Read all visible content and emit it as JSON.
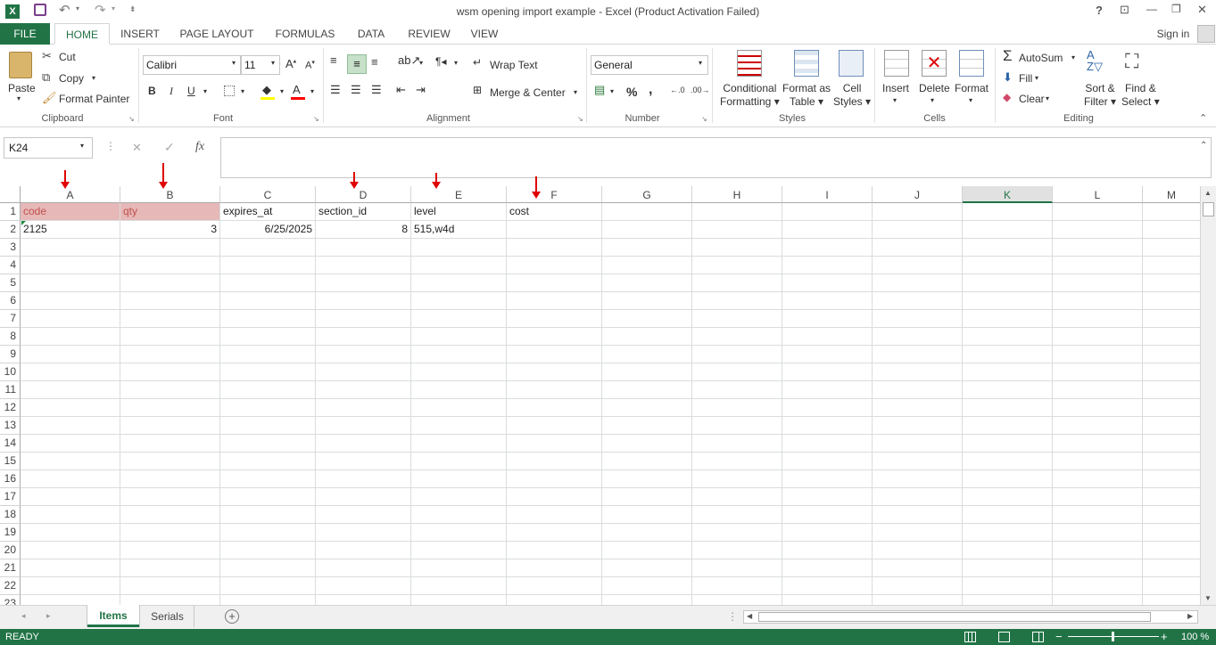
{
  "title": "wsm opening import example - Excel (Product Activation Failed)",
  "window_buttons": {
    "help": "?",
    "restore_ribbon": "⊡",
    "minimize": "—",
    "maximize": "❐",
    "close": "✕"
  },
  "ribbon_tabs": [
    "FILE",
    "HOME",
    "INSERT",
    "PAGE LAYOUT",
    "FORMULAS",
    "DATA",
    "REVIEW",
    "VIEW"
  ],
  "sign_in": "Sign in",
  "clipboard": {
    "paste": "Paste",
    "cut": "Cut",
    "copy": "Copy",
    "format_painter": "Format Painter",
    "label": "Clipboard"
  },
  "font": {
    "name": "Calibri",
    "size": "11",
    "bold": "B",
    "italic": "I",
    "underline": "U",
    "label": "Font"
  },
  "alignment": {
    "wrap_text": "Wrap Text",
    "merge_center": "Merge & Center",
    "label": "Alignment"
  },
  "number": {
    "format": "General",
    "percent": "%",
    "comma": ",",
    "label": "Number"
  },
  "styles": {
    "conditional": "Conditional",
    "formatting": "Formatting",
    "format_as": "Format as",
    "table": "Table",
    "cell": "Cell",
    "styles": "Styles",
    "label": "Styles"
  },
  "cells": {
    "insert": "Insert",
    "delete": "Delete",
    "format": "Format",
    "label": "Cells"
  },
  "editing": {
    "autosum": "AutoSum",
    "fill": "Fill",
    "clear": "Clear",
    "sort": "Sort &",
    "filter": "Filter",
    "find": "Find &",
    "select": "Select",
    "label": "Editing"
  },
  "formula_bar": {
    "name_box": "K24",
    "fx": "fx",
    "cancel": "✕",
    "enter": "✓",
    "value": ""
  },
  "columns": [
    "A",
    "B",
    "C",
    "D",
    "E",
    "F",
    "G",
    "H",
    "I",
    "J",
    "K",
    "L",
    "M"
  ],
  "selected_column": "K",
  "rows": [
    "1",
    "2",
    "3",
    "4",
    "5",
    "6",
    "7",
    "8",
    "9",
    "10",
    "11",
    "12",
    "13",
    "14",
    "15",
    "16",
    "17",
    "18",
    "19",
    "20",
    "21",
    "22",
    "23"
  ],
  "cells_data": {
    "A1": "code",
    "B1": "qty",
    "C1": "expires_at",
    "D1": "section_id",
    "E1": "level",
    "F1": "cost",
    "A2": "2125",
    "B2": "3",
    "C2": "6/25/2025",
    "D2": "8",
    "E2": "515,w4d"
  },
  "sheets": [
    "Items",
    "Serials"
  ],
  "active_sheet": "Items",
  "status": {
    "ready": "READY",
    "zoom": "100 %"
  },
  "colors": {
    "excel_green": "#217346",
    "header_fill": "#e6b8b7",
    "header_text": "#c0504d",
    "annotation_arrow": "#e00000"
  }
}
